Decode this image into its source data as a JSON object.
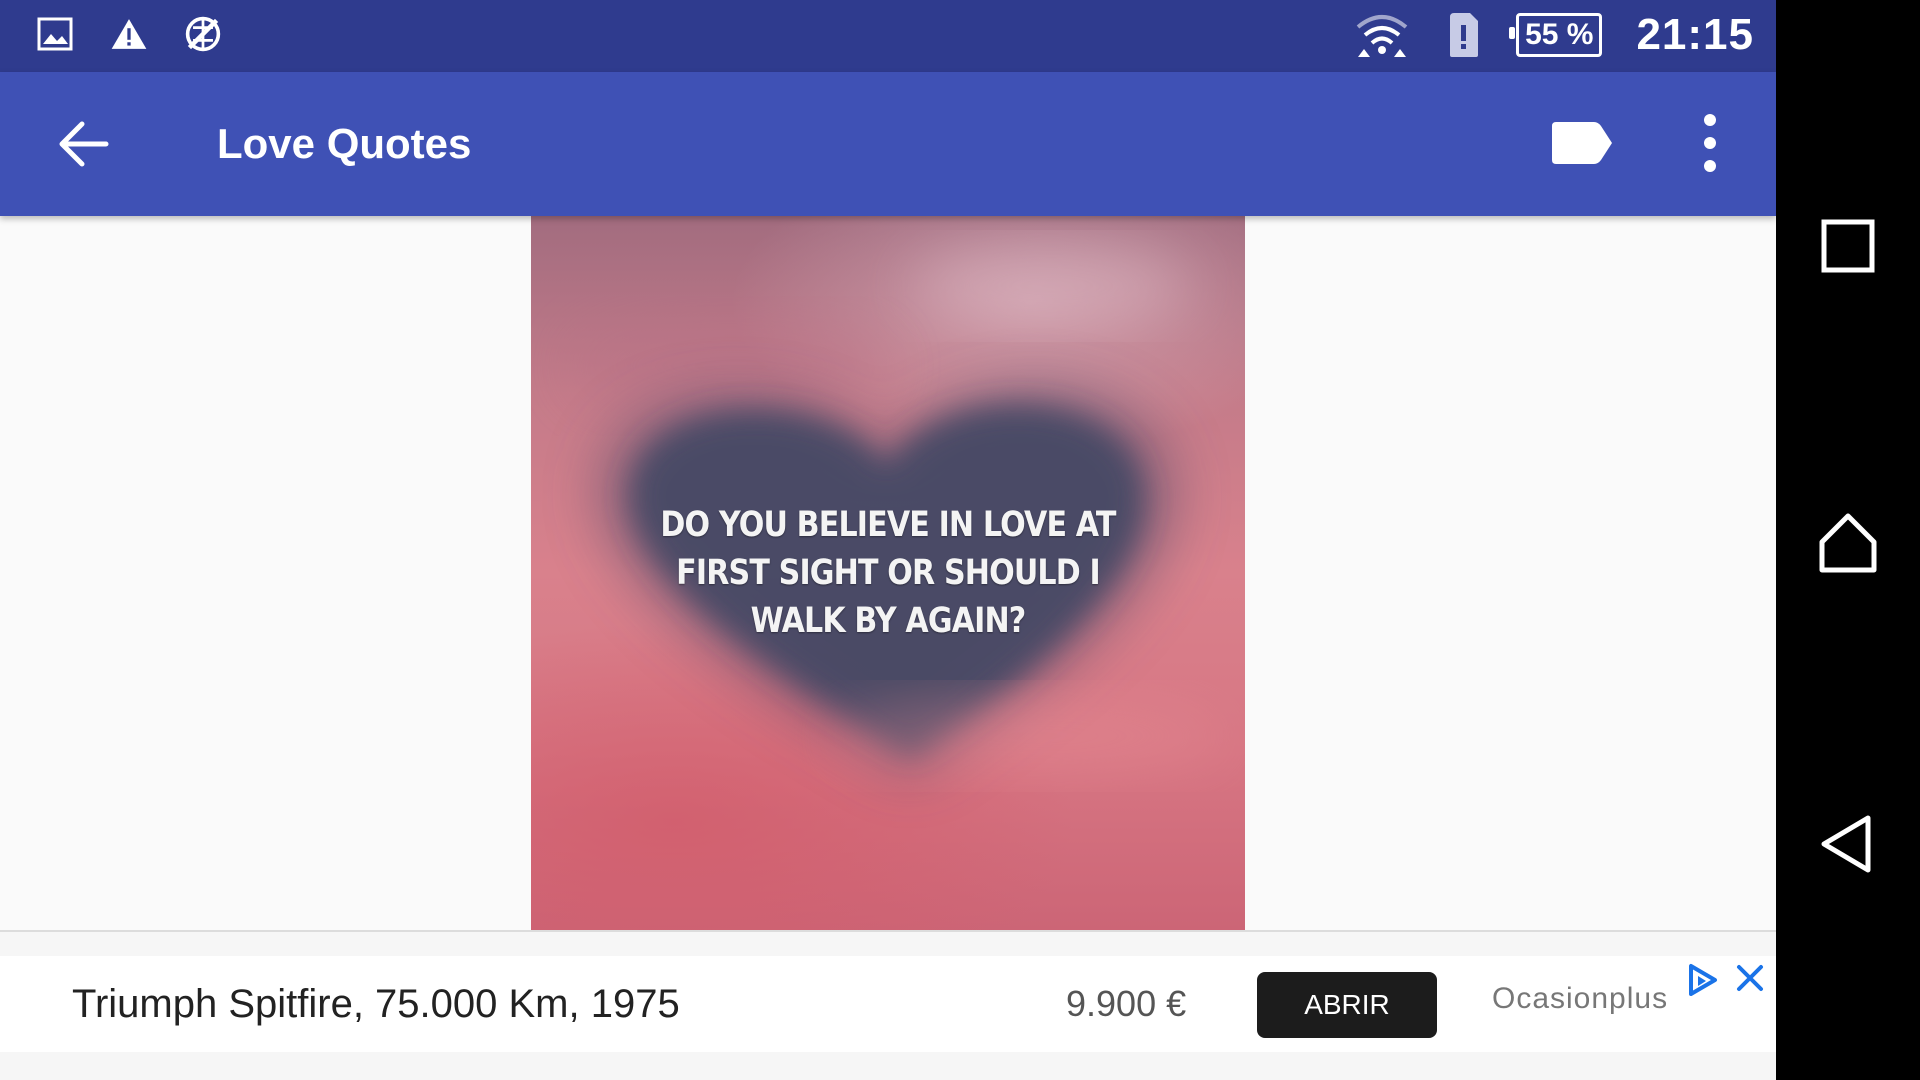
{
  "status_bar": {
    "left_icons": [
      "image-icon",
      "warning-icon",
      "no-sync-icon"
    ],
    "right_icons": [
      "wifi-icon",
      "sim-alert-icon"
    ],
    "battery": "55 %",
    "time": "21:15"
  },
  "app_bar": {
    "title": "Love Quotes",
    "background": "#3f51b5",
    "status_background": "#2f3b8e"
  },
  "quote": {
    "text": "Do you believe in love at first sight or should I walk by again?"
  },
  "ad": {
    "headline": "Triumph Spitfire, 75.000 Km, 1975",
    "price": "9.900 €",
    "cta": "ABRIR",
    "advertiser": "Ocasionplus",
    "accent": "#1a73e8"
  },
  "nav_bar": {
    "buttons": [
      "recents-icon",
      "home-icon",
      "back-icon"
    ]
  }
}
